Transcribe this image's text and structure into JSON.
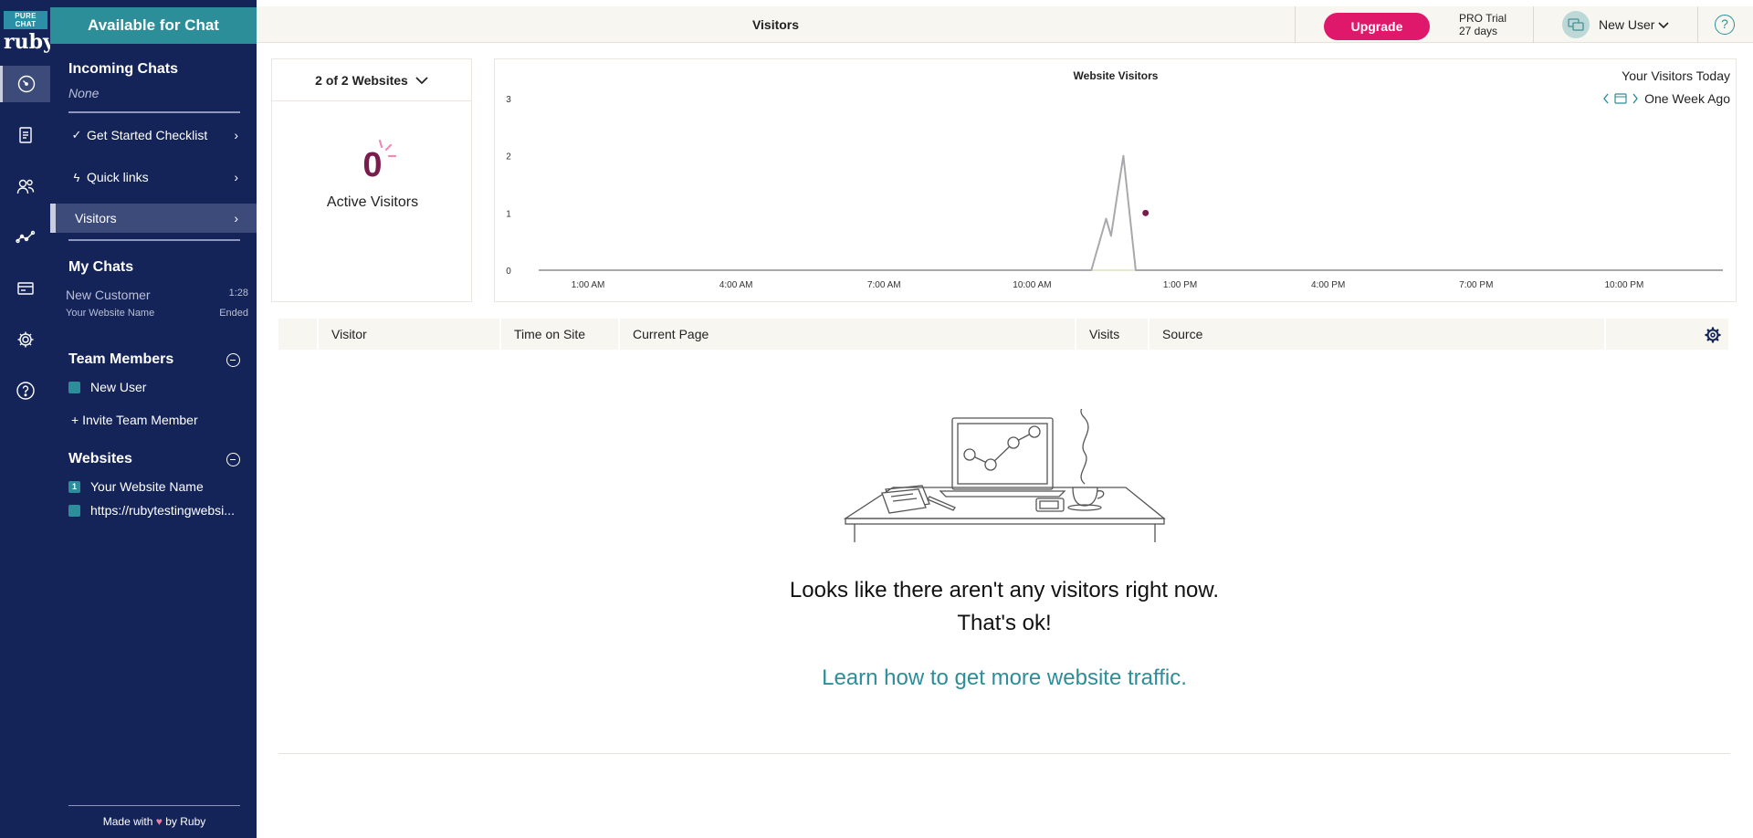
{
  "rail": {
    "logo_top": "PURE CHAT",
    "logo_bottom": "ruby"
  },
  "sidebar": {
    "status_button": "Available for Chat",
    "incoming_title": "Incoming Chats",
    "incoming_none": "None",
    "checklist": "Get Started Checklist",
    "quick_links": "Quick links",
    "visitors": "Visitors",
    "my_chats_title": "My Chats",
    "chats": [
      {
        "name": "New Customer",
        "time": "1:28",
        "site": "Your Website Name",
        "status": "Ended"
      }
    ],
    "team_title": "Team Members",
    "team_members": [
      "New User"
    ],
    "invite": "+ Invite Team Member",
    "websites_title": "Websites",
    "websites": [
      {
        "badge": "1",
        "name": "Your Website Name"
      },
      {
        "badge": "",
        "name": "https://rubytestingwebsi..."
      }
    ],
    "made_with_before": "Made with",
    "made_with_after": "by Ruby"
  },
  "topbar": {
    "title": "Visitors",
    "upgrade": "Upgrade",
    "trial_line1": "PRO Trial",
    "trial_line2": "27 days",
    "user_name": "New User",
    "help": "?"
  },
  "websites_card": {
    "selector": "2 of 2 Websites",
    "active_count": "0",
    "active_label": "Active Visitors"
  },
  "colors": {
    "navy": "#142459",
    "teal": "#2b8e98",
    "pink": "#e0186b",
    "plum": "#7a1c4e"
  },
  "chart_data": {
    "type": "line",
    "title": "Website Visitors",
    "legend": [
      "Your Visitors Today",
      "One Week Ago"
    ],
    "x_ticks": [
      "1:00 AM",
      "4:00 AM",
      "7:00 AM",
      "10:00 AM",
      "1:00 PM",
      "4:00 PM",
      "7:00 PM",
      "10:00 PM"
    ],
    "y_ticks": [
      0,
      1,
      2,
      3
    ],
    "ylim": [
      0,
      3
    ],
    "xlim_hours": [
      0,
      24
    ],
    "series": [
      {
        "name": "One Week Ago",
        "color": "#a8a8ad",
        "points": [
          [
            0,
            0
          ],
          [
            11.2,
            0
          ],
          [
            11.5,
            0.9
          ],
          [
            11.6,
            0.6
          ],
          [
            11.75,
            1.45
          ],
          [
            11.85,
            2.0
          ],
          [
            11.95,
            1.2
          ],
          [
            12.1,
            0
          ],
          [
            24,
            0
          ]
        ]
      },
      {
        "name": "Your Visitors Today",
        "color": "#7a1c4e",
        "points": [
          [
            12.3,
            1.0
          ]
        ]
      }
    ]
  },
  "table": {
    "columns": [
      "",
      "Visitor",
      "Time on Site",
      "Current Page",
      "Visits",
      "Source",
      ""
    ]
  },
  "empty_state": {
    "line1": "Looks like there aren't any visitors right now.",
    "line2": "That's ok!",
    "link": "Learn how to get more website traffic."
  }
}
